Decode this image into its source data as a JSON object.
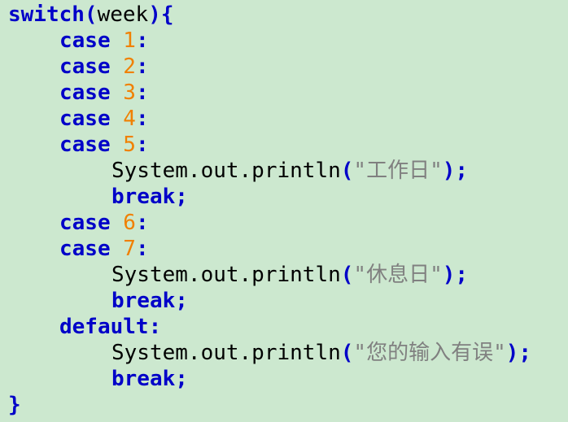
{
  "colors": {
    "background": "#cce8cf",
    "keyword": "#0000c8",
    "number": "#f08000",
    "string": "#808080",
    "text": "#000000"
  },
  "code": {
    "switch_kw": "switch",
    "switch_arg": "week",
    "case_kw": "case",
    "case_values": [
      "1",
      "2",
      "3",
      "4",
      "5",
      "6",
      "7"
    ],
    "colon": ":",
    "print_call": "System.out.println",
    "string_workday": "\"工作日\"",
    "string_rest": "\"休息日\"",
    "string_error": "\"您的输入有误\"",
    "break_kw": "break",
    "default_kw": "default",
    "semicolon": ";",
    "open_brace": "{",
    "close_brace": "}"
  }
}
